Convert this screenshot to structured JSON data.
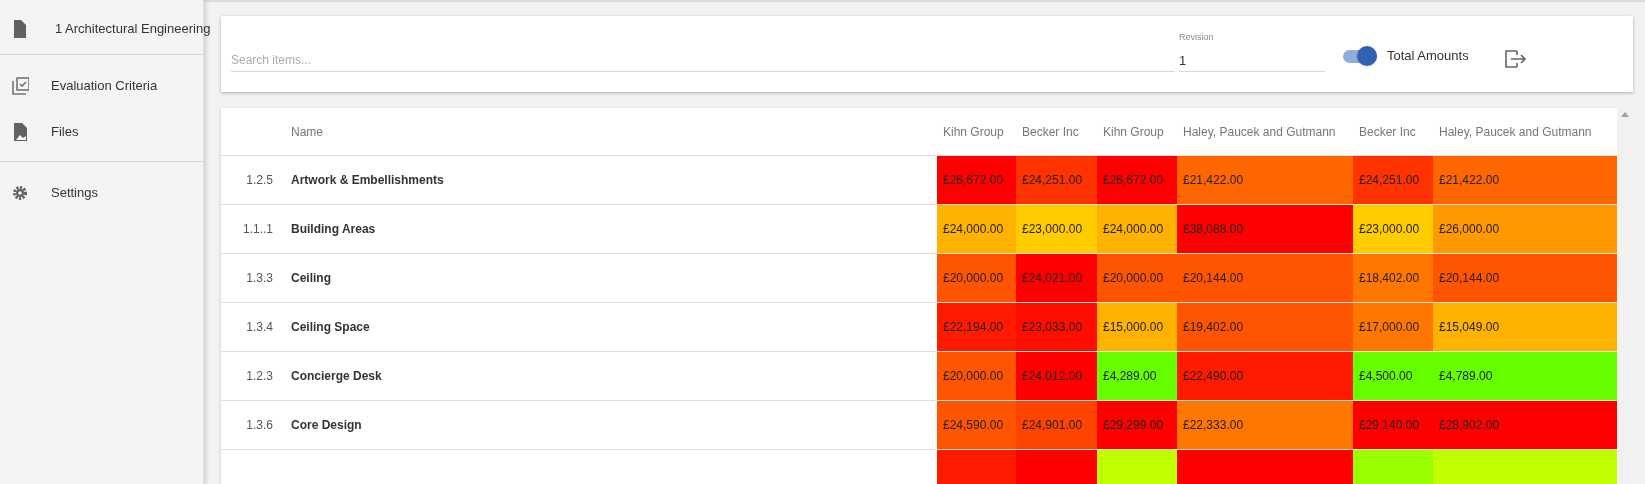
{
  "sidebar": {
    "items": [
      {
        "kind": "document",
        "label": "1 Architectural Engineering",
        "divider_after": true
      },
      {
        "kind": "checklist",
        "label": "Evaluation Criteria",
        "divider_after": false
      },
      {
        "kind": "file",
        "label": "Files",
        "divider_after": true
      },
      {
        "kind": "gear",
        "label": "Settings",
        "divider_after": false
      }
    ]
  },
  "toolbar": {
    "search": {
      "placeholder": "Search items..."
    },
    "revision": {
      "label": "Revision",
      "value": "1"
    },
    "total_amounts": {
      "label": "Total Amounts",
      "on": true
    }
  },
  "table": {
    "columns": [
      "Name",
      "Kihn Group",
      "Becker Inc",
      "Kihn Group",
      "Haley, Paucek and Gutmann",
      "Becker Inc",
      "Haley, Paucek and Gutmann"
    ],
    "rows": [
      {
        "number": "1.2.5",
        "cells": [
          {
            "text": "Artwork & Embellishments"
          },
          {
            "text": "£26,672.00",
            "color": "#ff0000"
          },
          {
            "text": "£24,251.00",
            "color": "#ff3300"
          },
          {
            "text": "£26,672.00",
            "color": "#ff0000"
          },
          {
            "text": "£21,422.00",
            "color": "#ff6600"
          },
          {
            "text": "£24,251.00",
            "color": "#ff3300"
          },
          {
            "text": "£21,422.00",
            "color": "#ff6600"
          }
        ]
      },
      {
        "number": "1.1..1",
        "cells": [
          {
            "text": "Building Areas"
          },
          {
            "text": "£24,000.00",
            "color": "#ffb300"
          },
          {
            "text": "£23,000.00",
            "color": "#ffcc00"
          },
          {
            "text": "£24,000.00",
            "color": "#ffb300"
          },
          {
            "text": "£38,088.00",
            "color": "#ff0000"
          },
          {
            "text": "£23,000.00",
            "color": "#ffcc00"
          },
          {
            "text": "£26,000.00",
            "color": "#ff9900"
          }
        ]
      },
      {
        "number": "1.3.3",
        "cells": [
          {
            "text": "Ceiling"
          },
          {
            "text": "£20,000.00",
            "color": "#ff5500"
          },
          {
            "text": "£24,021.00",
            "color": "#ff0000"
          },
          {
            "text": "£20,000.00",
            "color": "#ff5500"
          },
          {
            "text": "£20,144.00",
            "color": "#ff5500"
          },
          {
            "text": "£18,402.00",
            "color": "#ff7700"
          },
          {
            "text": "£20,144.00",
            "color": "#ff5500"
          }
        ]
      },
      {
        "number": "1.3.4",
        "cells": [
          {
            "text": "Ceiling Space"
          },
          {
            "text": "£22,194.00",
            "color": "#ff1a00"
          },
          {
            "text": "£23,033.00",
            "color": "#ff0d00"
          },
          {
            "text": "£15,000.00",
            "color": "#ffb300"
          },
          {
            "text": "£19,402.00",
            "color": "#ff5500"
          },
          {
            "text": "£17,000.00",
            "color": "#ff7700"
          },
          {
            "text": "£15,049.00",
            "color": "#ffb300"
          }
        ]
      },
      {
        "number": "1.2.3",
        "cells": [
          {
            "text": "Concierge Desk"
          },
          {
            "text": "£20,000.00",
            "color": "#ff5500"
          },
          {
            "text": "£24,012.00",
            "color": "#ff0000"
          },
          {
            "text": "£4,289.00",
            "color": "#66ff00"
          },
          {
            "text": "£22,490.00",
            "color": "#ff1a00"
          },
          {
            "text": "£4,500.00",
            "color": "#66ff00"
          },
          {
            "text": "£4,789.00",
            "color": "#66ff00"
          }
        ]
      },
      {
        "number": "1.3.6",
        "cells": [
          {
            "text": "Core Design"
          },
          {
            "text": "£24,590.00",
            "color": "#ff5500"
          },
          {
            "text": "£24,901.00",
            "color": "#ff4400"
          },
          {
            "text": "£29,299.00",
            "color": "#ff0000"
          },
          {
            "text": "£22,333.00",
            "color": "#ff7700"
          },
          {
            "text": "£29,140.00",
            "color": "#ff0000"
          },
          {
            "text": "£28,902.00",
            "color": "#ff0000"
          }
        ]
      },
      {
        "cells": [
          {},
          {
            "color": "#ff1a00"
          },
          {
            "color": "#ff0000"
          },
          {
            "color": "#bfff00"
          },
          {
            "color": "#ff0000"
          },
          {
            "color": "#99ff00"
          },
          {
            "color": "#bfff00"
          }
        ]
      }
    ]
  }
}
